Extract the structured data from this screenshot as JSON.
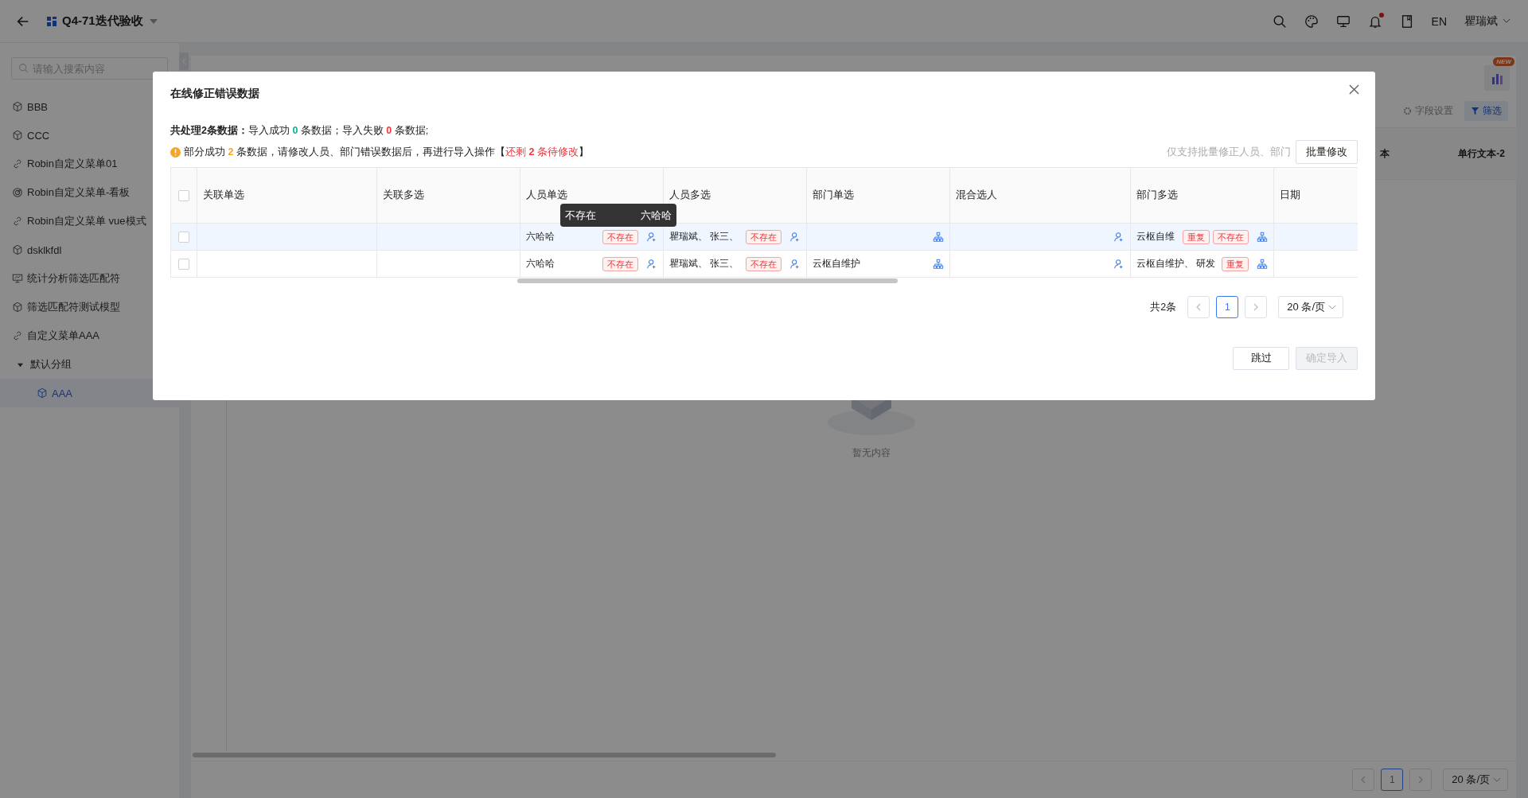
{
  "app": {
    "title": "Q4-71迭代验收"
  },
  "header": {
    "language": "EN",
    "user": "瞿瑞斌",
    "has_notification": true
  },
  "sidebar": {
    "search": {
      "placeholder": "请输入搜索内容"
    },
    "items": [
      {
        "label": "BBB",
        "kind": "cube",
        "selected": false
      },
      {
        "label": "CCC",
        "kind": "cube",
        "selected": false
      },
      {
        "label": "Robin自定义菜单01",
        "kind": "link",
        "selected": false
      },
      {
        "label": "Robin自定义菜单-看板",
        "kind": "dashboard",
        "selected": false
      },
      {
        "label": "Robin自定义菜单 vue模式",
        "kind": "link",
        "selected": false
      },
      {
        "label": "dsklkfdl",
        "kind": "cube",
        "selected": false
      },
      {
        "label": "统计分析筛选匹配符",
        "kind": "screen",
        "selected": false
      },
      {
        "label": "筛选匹配符测试模型",
        "kind": "cube",
        "selected": false
      },
      {
        "label": "自定义菜单AAA",
        "kind": "link",
        "selected": false
      },
      {
        "label": "默认分组",
        "kind": "group",
        "expanded": true,
        "selected": false,
        "children": [
          {
            "label": "AAA",
            "kind": "cube",
            "selected": true
          }
        ]
      }
    ]
  },
  "background": {
    "new_badge": "NEW",
    "toolbar": [
      {
        "label": "字段设置",
        "kind": "settings"
      },
      {
        "label": "筛选",
        "kind": "filter"
      }
    ],
    "columns": [
      "本",
      "单行文本-2"
    ],
    "empty_text": "暂无内容",
    "pagination": {
      "page": "1",
      "page_size": "20 条/页"
    }
  },
  "dialog": {
    "title": "在线修正错误数据",
    "summary": [
      {
        "text": "共处理2条数据：",
        "kind": "bold"
      },
      {
        "text": "导入成功 ",
        "kind": "plain"
      },
      {
        "text": "0",
        "kind": "success"
      },
      {
        "text": " 条数据；导入失败 ",
        "kind": "plain"
      },
      {
        "text": "0",
        "kind": "error"
      },
      {
        "text": " 条数据;",
        "kind": "plain"
      }
    ],
    "warning": [
      {
        "text": "部分成功 ",
        "kind": "plain"
      },
      {
        "text": "2",
        "kind": "warn"
      },
      {
        "text": " 条数据，请修改人员、部门错误数据后，再进行导入操作【",
        "kind": "plain"
      },
      {
        "text": "还剩 ",
        "kind": "error_light"
      },
      {
        "text": "2",
        "kind": "error"
      },
      {
        "text": " 条待修改",
        "kind": "error_light"
      },
      {
        "text": "】",
        "kind": "plain"
      }
    ],
    "batch_hint": "仅支持批量修正人员、部门",
    "batch_button": "批量修改",
    "header_checked": false,
    "columns": [
      "关联单选",
      "关联多选",
      "人员单选",
      "人员多选",
      "部门单选",
      "混合选人",
      "部门多选",
      "日期"
    ],
    "rows": [
      {
        "checked": false,
        "hovered": true,
        "cells": [
          {},
          {},
          {
            "text": "六哈哈",
            "tags": [
              "不存在"
            ]
          },
          {
            "text": "瞿瑞斌、 张三、",
            "tags": [
              "不存在"
            ]
          },
          {},
          {},
          {
            "text": "云枢自维",
            "tags": [
              "重复",
              "不存在"
            ]
          },
          {}
        ]
      },
      {
        "checked": false,
        "hovered": false,
        "cells": [
          {},
          {},
          {
            "text": "六哈哈",
            "tags": [
              "不存在"
            ]
          },
          {
            "text": "瞿瑞斌、 张三、",
            "tags": [
              "不存在"
            ]
          },
          {
            "text": "云枢自维护"
          },
          {},
          {
            "text": "云枢自维护、 研发",
            "tags": [
              "重复"
            ]
          },
          {}
        ]
      }
    ],
    "tooltip": {
      "left": "不存在",
      "right": "六哈哈"
    },
    "pagination": {
      "total": "共2条",
      "page": "1",
      "page_size": "20 条/页"
    },
    "buttons": [
      {
        "label": "跳过",
        "disabled": false
      },
      {
        "label": "确定导入",
        "disabled": true
      }
    ]
  }
}
